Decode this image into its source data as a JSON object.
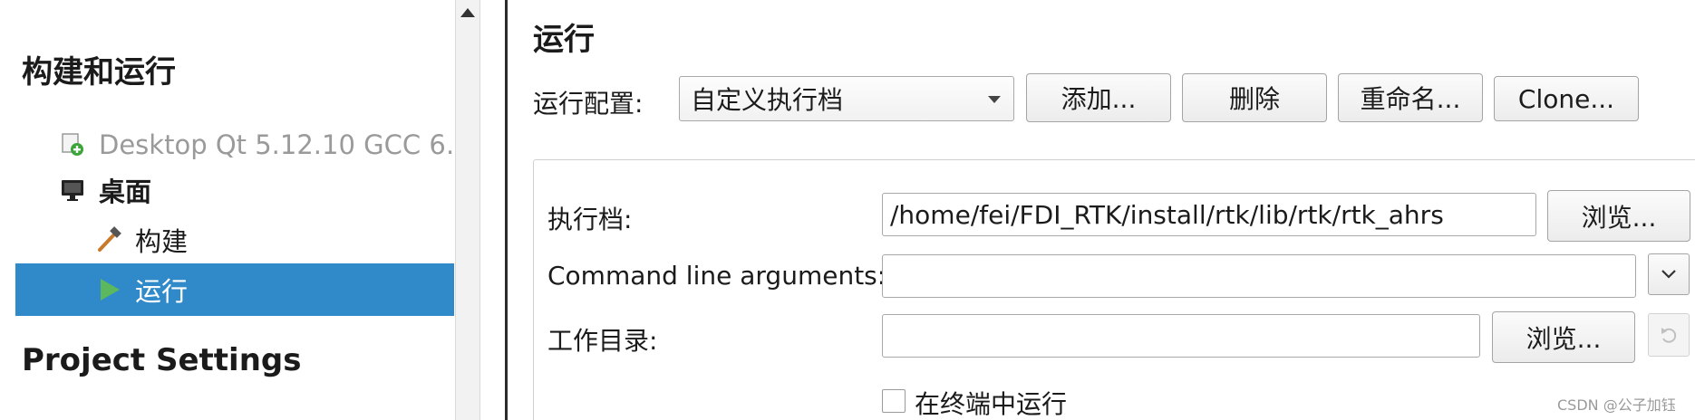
{
  "sidebar": {
    "build_run_title": "构建和运行",
    "kit_label": "Desktop Qt 5.12.10 GCC 6…",
    "desktop_label": "桌面",
    "build_label": "构建",
    "run_label": "运行",
    "project_settings_title": "Project Settings",
    "selected_color": "#3089c8"
  },
  "run": {
    "title": "运行",
    "config_label": "运行配置:",
    "config_value": "自定义执行档",
    "add_button": "添加...",
    "delete_button": "删除",
    "rename_button": "重命名...",
    "clone_button": "Clone...",
    "executable_label": "执行档:",
    "executable_value": "/home/fei/FDI_RTK/install/rtk/lib/rtk/rtk_ahrs",
    "browse_button": "浏览...",
    "args_label": "Command line arguments:",
    "args_value": "",
    "workdir_label": "工作目录:",
    "workdir_value": "",
    "browse_button_2": "浏览...",
    "terminal_label": "在终端中运行"
  },
  "watermark": "CSDN @公子加钰"
}
